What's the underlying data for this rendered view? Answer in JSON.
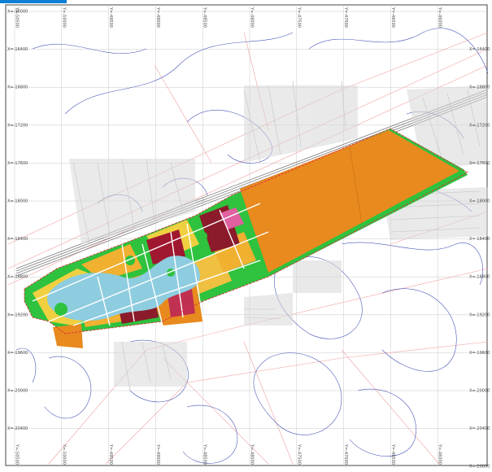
{
  "map": {
    "grid_y_labels_left": [
      "X=-16000",
      "X=-16400",
      "X=-16800",
      "X=-17200",
      "X=-17600",
      "X=-18000",
      "X=-18400",
      "X=-18800",
      "X=-19200",
      "X=-19600",
      "X=-20000",
      "X=-20400"
    ],
    "grid_y_labels_right": [
      "X=-16400",
      "X=-16800",
      "X=-17200",
      "X=-17600",
      "X=-18000",
      "X=-18400",
      "X=-18800",
      "X=-19200",
      "X=-19600",
      "X=-20000",
      "X=-20400",
      "X=-20800"
    ],
    "grid_x_labels_top": [
      "Y=-50500",
      "Y=-50000",
      "Y=-49500",
      "Y=-49000",
      "Y=-48500",
      "Y=-48000",
      "Y=-47500",
      "Y=-47000",
      "Y=-46500",
      "Y=-46000"
    ],
    "grid_x_labels_bottom": [
      "Y=-50500",
      "Y=-50000",
      "Y=-49500",
      "Y=-49000",
      "Y=-48500",
      "Y=-48000",
      "Y=-47500",
      "Y=-47000",
      "Y=-46500",
      "Y=-46000"
    ],
    "colors": {
      "industrial": "#e88a1e",
      "residential": "#f0d040",
      "commercial": "#8b1a2a",
      "green": "#2ec23e",
      "water": "#8ecde0",
      "road_outline": "#e05050",
      "contour": "#4a58b8",
      "base_lines": "#9a9a9a"
    }
  }
}
